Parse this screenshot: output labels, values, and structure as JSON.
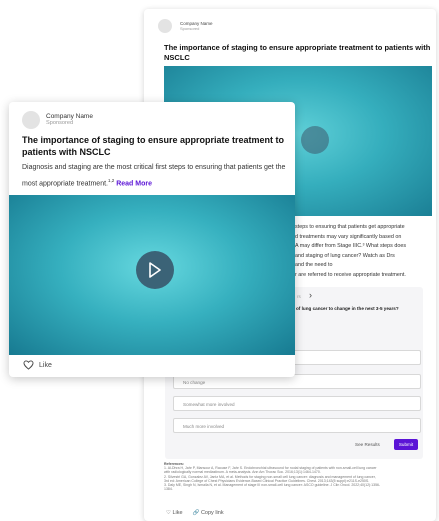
{
  "ad": {
    "company": "Company Name",
    "sponsored": "Sponsored",
    "title": "The importance of staging to ensure appropriate treatment to patients with NSCLC",
    "description": "Diagnosis and staging are the most critical first steps to ensuring that patients get the most appropriate treatment.",
    "description_sup": "1,2",
    "read_more": "Read More",
    "like_label": "Like",
    "copy_link_label": "Copy link"
  },
  "back": {
    "body_lines": [
      "steps to ensuring that patients get appropriate",
      "d treatments may vary significantly based on",
      "A may differ from Stage IIIC.³ What steps does",
      "and staging of lung cancer? Watch as Drs",
      "and the need to",
      "r are referred to receive appropriate treatment."
    ],
    "poll_prefix": "rs",
    "poll_question": "of lung cancer to change in the next 3-5 years?",
    "options": [
      "",
      "",
      "No change",
      "Somewhat more involved",
      "Much more involved"
    ],
    "see_results": "See Results",
    "submit": "Submit",
    "refs_heading": "References:",
    "refs_lines": [
      "1. Al-Dhra H, Jahr P, Mansour A, Raouse F, Jahr S. Endobronchial ultrasound for nodal staging of patients with non-small-cell lung cancer",
      "with radiologically normal mediastinum. A meta-analysis. Ann Am Thorac Soc. 2016;13(1):1464-1470.",
      "2. Silvestri GA, Gonzalez AV, Jantz MA, et al. Methods for staging non-small cell lung cancer: diagnosis and management of lung cancer,",
      "3rd ed: American College of Chest Physicians Evidence-Based Clinical Practice Guidelines. Chest. 2013;143(5 suppl):e211S-e250S.",
      "3. Daly ME, Singh N, Ismaila N, et al. Management of stage III non-small-cell lung cancer: ASCO guideline. J Clin Oncol. 2022;40(12):1356-",
      "1384."
    ]
  },
  "colors": {
    "accent": "#5b14d6",
    "video": "#36b0bf"
  }
}
